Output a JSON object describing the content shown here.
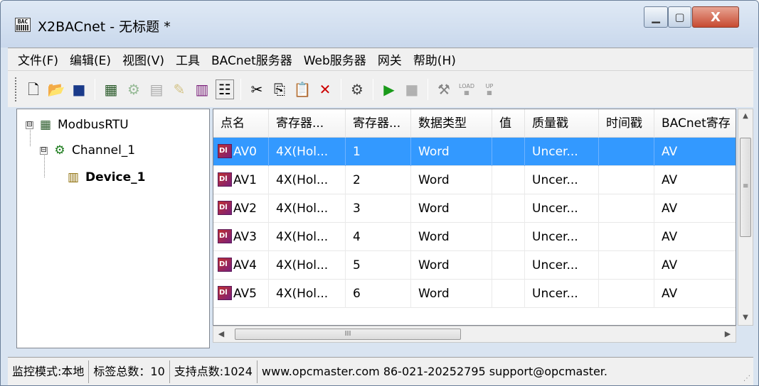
{
  "window": {
    "title": "X2BACnet - 无标题 *",
    "icon_label": "BAC",
    "controls": {
      "minimize": "minimize-icon",
      "maximize": "maximize-icon",
      "close_label": "X"
    }
  },
  "menu": [
    "文件(F)",
    "编辑(E)",
    "视图(V)",
    "工具",
    "BACnet服务器",
    "Web服务器",
    "网关",
    "帮助(H)"
  ],
  "toolbar": {
    "icons": [
      "new-file-icon",
      "open-folder-icon",
      "save-icon",
      "add-channel-icon",
      "add-device-icon",
      "add-group-icon",
      "add-tag-icon",
      "batch-add-icon",
      "properties-icon",
      "cut-icon",
      "copy-icon",
      "paste-icon",
      "delete-icon",
      "monitor-icon",
      "run-icon",
      "stop-icon",
      "tools-icon",
      "load-icon",
      "load-up-icon"
    ],
    "load_label": "LOAD",
    "up_label": "UP"
  },
  "tree": {
    "root": "ModbusRTU",
    "channel": "Channel_1",
    "device": "Device_1",
    "expander": "⊟"
  },
  "table": {
    "headers": [
      "点名",
      "寄存器...",
      "寄存器...",
      "数据类型",
      "值",
      "质量戳",
      "时间戳",
      "BACnet寄存"
    ],
    "rows": [
      [
        "AV0",
        "4X(Hol...",
        "1",
        "Word",
        "",
        "Uncer...",
        "",
        "AV"
      ],
      [
        "AV1",
        "4X(Hol...",
        "2",
        "Word",
        "",
        "Uncer...",
        "",
        "AV"
      ],
      [
        "AV2",
        "4X(Hol...",
        "3",
        "Word",
        "",
        "Uncer...",
        "",
        "AV"
      ],
      [
        "AV3",
        "4X(Hol...",
        "4",
        "Word",
        "",
        "Uncer...",
        "",
        "AV"
      ],
      [
        "AV4",
        "4X(Hol...",
        "5",
        "Word",
        "",
        "Uncer...",
        "",
        "AV"
      ],
      [
        "AV5",
        "4X(Hol...",
        "6",
        "Word",
        "",
        "Uncer...",
        "",
        "AV"
      ]
    ],
    "selected_row": 0
  },
  "status": {
    "mode": "监控模式:本地",
    "tag_count": "标签总数：10",
    "support": "支持点数:1024",
    "contact": "www.opcmaster.com 86-021-20252795 support@opcmaster."
  },
  "colors": {
    "selection": "#3399ff",
    "close_button": "#c74a31"
  }
}
